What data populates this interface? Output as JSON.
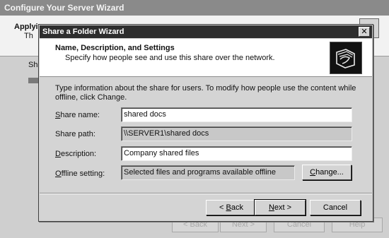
{
  "background_window": {
    "title": "Configure Your Server Wizard",
    "heading": "Applyi",
    "subheading": "Th",
    "body_text": "Sha",
    "buttons": {
      "back": "< Back",
      "next": "Next >",
      "cancel": "Cancel",
      "help": "Help"
    }
  },
  "dialog": {
    "title": "Share a Folder Wizard",
    "close_glyph": "✕",
    "heading": "Name, Description, and Settings",
    "subheading": "Specify how people see and use this share over the network.",
    "header_icon": "shared-folder-icon",
    "intro": "Type information about the share for users. To modify how people use the content while offline, click Change.",
    "fields": {
      "share_name": {
        "label_hot": "S",
        "label_rest": "hare name:",
        "value": "shared docs"
      },
      "share_path": {
        "label": "Share path:",
        "value": "\\\\SERVER1\\shared docs"
      },
      "description": {
        "label_hot": "D",
        "label_rest": "escription:",
        "value": "Company shared files"
      },
      "offline": {
        "label_hot": "O",
        "label_rest": "ffline setting:",
        "value": "Selected files and programs available offline"
      }
    },
    "buttons": {
      "change_hot": "C",
      "change_rest": "hange...",
      "back_pre": "< ",
      "back_hot": "B",
      "back_rest": "ack",
      "next_hot": "N",
      "next_rest": "ext >",
      "cancel": "Cancel"
    }
  }
}
